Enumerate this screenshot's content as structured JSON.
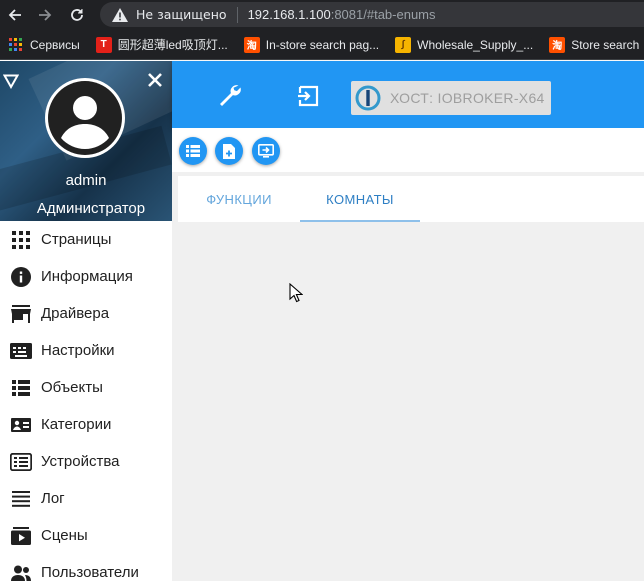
{
  "browser": {
    "security_label": "Не защищено",
    "url_host": "192.168.1.100",
    "url_rest": ":8081/#tab-enums",
    "bookmarks": [
      {
        "label": "Сервисы",
        "icon": "apps-grid-icon"
      },
      {
        "label": "圆形超薄led吸顶灯...",
        "icon": "t-brand-icon",
        "color": "#e32119"
      },
      {
        "label": "In-store search pag...",
        "icon": "taobao-icon",
        "color": "#ff5000"
      },
      {
        "label": "Wholesale_Supply_...",
        "icon": "folder-icon",
        "color": "#f6b400"
      },
      {
        "label": "Store search",
        "icon": "taobao-icon",
        "color": "#ff5000"
      }
    ]
  },
  "user": {
    "name": "admin",
    "role": "Администратор"
  },
  "menu": {
    "items": [
      {
        "label": "Страницы",
        "icon": "grid-icon"
      },
      {
        "label": "Информация",
        "icon": "info-icon"
      },
      {
        "label": "Драйвера",
        "icon": "store-icon"
      },
      {
        "label": "Настройки",
        "icon": "keyboard-icon"
      },
      {
        "label": "Объекты",
        "icon": "list-icon"
      },
      {
        "label": "Категории",
        "icon": "category-card-icon"
      },
      {
        "label": "Устройства",
        "icon": "device-list-icon"
      },
      {
        "label": "Лог",
        "icon": "log-lines-icon"
      },
      {
        "label": "Сцены",
        "icon": "scene-icon"
      },
      {
        "label": "Пользователи",
        "icon": "users-icon"
      }
    ]
  },
  "topbar": {
    "host_label": "ХОСТ: IOBROKER-X64"
  },
  "tabs": [
    {
      "label": "ФУНКЦИИ",
      "active": false
    },
    {
      "label": "КОМНАТЫ",
      "active": true
    }
  ],
  "colors": {
    "primary": "#2196f3",
    "browser_dark": "#202124",
    "tab_text": "#64a6dc",
    "content_bg": "#f0f0f0"
  }
}
